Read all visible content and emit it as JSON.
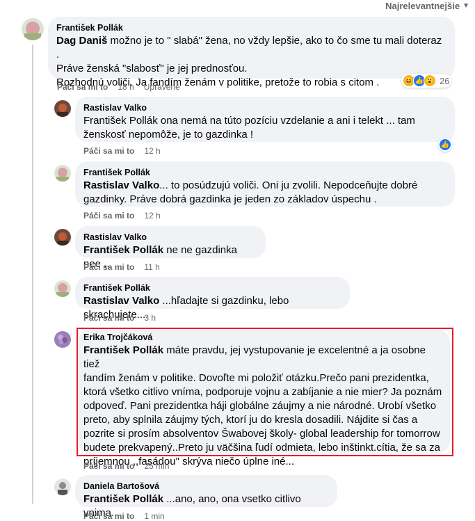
{
  "sort_label": "Najrelevantnejšie",
  "comments": [
    {
      "author": "František Pollák",
      "mention": "Dag Daniš",
      "lines": [
        " možno je to \" slabá\" žena, no vždy lepšie, ako to čo sme tu mali doteraz .",
        "Práve ženská \"slabosť\" je jej prednosťou.",
        "Rozhodnú voliči. Ja fandím ženám v politike, pretože to robia s citom ."
      ],
      "like_label": "Páči sa mi to",
      "time": "18 h",
      "edited": "Upravené",
      "reaction_count": "26",
      "reaction_icons": [
        "haha-icon",
        "like-icon",
        "wow-icon"
      ]
    },
    {
      "author": "Rastislav Valko",
      "lines": [
        "František Pollák ona nemá na túto pozíciu vzdelanie a ani i telekt ... tam",
        "ženskosť nepomôže, je to gazdinka !"
      ],
      "like_label": "Páči sa mi to",
      "time": "12 h",
      "reaction_icons": [
        "like-icon"
      ]
    },
    {
      "author": "František Pollák",
      "mention": "Rastislav Valko",
      "lines": [
        "... to posúdzujú voliči. Oni ju zvolili. Nepodceňujte dobré",
        "gazdinky. Práve dobrá gazdinka je jeden zo základov úspechu ."
      ],
      "like_label": "Páči sa mi to",
      "time": "12 h"
    },
    {
      "author": "Rastislav Valko",
      "mention": "František Pollák",
      "lines": [
        " ne ne gazdinka nee ..."
      ],
      "like_label": "Páči sa mi to",
      "time": "11 h"
    },
    {
      "author": "František Pollák",
      "mention": "Rastislav Valko",
      "lines": [
        " ...hľadajte si gazdinku, lebo skrachujete...."
      ],
      "like_label": "Páči sa mi to",
      "time": "3 h"
    },
    {
      "author": "Erika Trojčáková",
      "mention": "František Pollák",
      "lines": [
        " máte pravdu, jej vystupovanie je excelentné a ja osobne tiež",
        "fandím ženám v politike. Dovoľte mi položiť otázku.Prečo pani prezidentka,",
        "ktorá všetko citlivo vníma, podporuje vojnu a zabíjanie a nie mier? Ja poznám",
        "odpoveď. Pani prezidentka háji globálne záujmy a nie národné. Urobí všetko",
        "preto, aby splnila záujmy tých, ktorí ju do kresla dosadili. Nájdite si čas a",
        "pozrite si prosím absolventov Šwabovej školy- global leadership for tomorrow",
        "budete prekvapený..Preto ju väčšina ľudí odmieta, lebo inštinkt.cítia, že sa za",
        "príjemnou ,,fasádou\" skrýva niečo úplne iné..."
      ],
      "like_label": "Páči sa mi to",
      "time": "25 min"
    },
    {
      "author": "Daniela Bartošová",
      "mention": "František Pollák",
      "lines": [
        " ...ano, ano, ona vsetko citlivo vnima..."
      ],
      "like_label": "Páči sa mi to",
      "time": "1 min"
    }
  ],
  "colors": {
    "bubble": "#f0f2f5",
    "highlight": "#e41e2a",
    "like_blue": "#1877f2",
    "meta_gray": "#65676b"
  }
}
